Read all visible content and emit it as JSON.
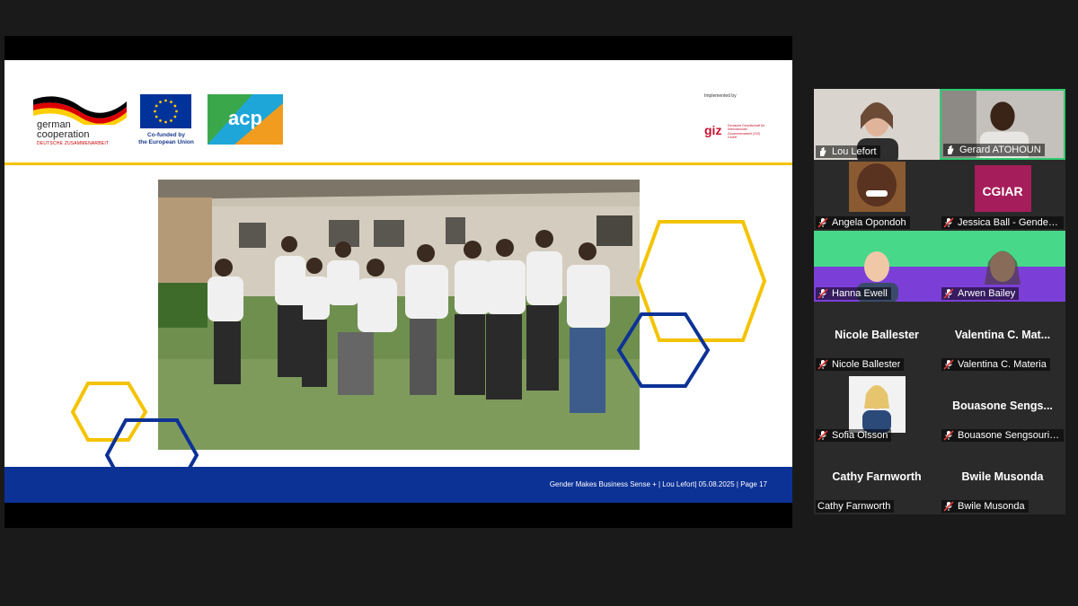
{
  "slide": {
    "german_cooperation": {
      "line1": "german",
      "line2": "cooperation",
      "line3": "DEUTSCHE ZUSAMMENARBEIT"
    },
    "eu": {
      "line1": "Co-funded by",
      "line2": "the European Union"
    },
    "acp_label": "acp",
    "implemented_by": "Implemented by",
    "giz": {
      "logo": "giz",
      "sub": "Deutsche Gesellschaft für Internationale Zusammenarbeit (GIZ) GmbH"
    },
    "footer": "Gender Makes Business Sense + | Lou Lefort| 05.08.2025  |  Page 17",
    "colors": {
      "yellow": "#f4c300",
      "blue": "#0d3296"
    }
  },
  "participants": [
    {
      "name": "Lou Lefort",
      "display": "video",
      "muted": false,
      "icon": "raise-hand-icon"
    },
    {
      "name": "Gerard ATOHOUN",
      "display": "video",
      "muted": false,
      "active_speaker": true,
      "icon": "raise-hand-icon"
    },
    {
      "name": "Angela Opondoh",
      "display": "video",
      "muted": true
    },
    {
      "name": "Jessica Ball - Gender ...",
      "display": "logo",
      "muted": true
    },
    {
      "name": "Hanna Ewell",
      "display": "video",
      "muted": true
    },
    {
      "name": "Arwen Bailey",
      "display": "video",
      "muted": true
    },
    {
      "name": "Nicole Ballester",
      "big_name": "Nicole Ballester",
      "display": "name",
      "muted": true
    },
    {
      "name": "Valentina C. Materia",
      "big_name": "Valentina  C.  Mat...",
      "display": "name",
      "muted": true
    },
    {
      "name": "Sofia Olsson",
      "display": "photo",
      "muted": true
    },
    {
      "name": "Bouasone Sengsouriv...",
      "big_name": "Bouasone  Sengs...",
      "display": "name",
      "muted": true
    },
    {
      "name": "Cathy Farnworth",
      "big_name": "Cathy Farnworth",
      "display": "name",
      "muted": false
    },
    {
      "name": "Bwile Musonda",
      "big_name": "Bwile Musonda",
      "display": "name",
      "muted": true
    }
  ]
}
